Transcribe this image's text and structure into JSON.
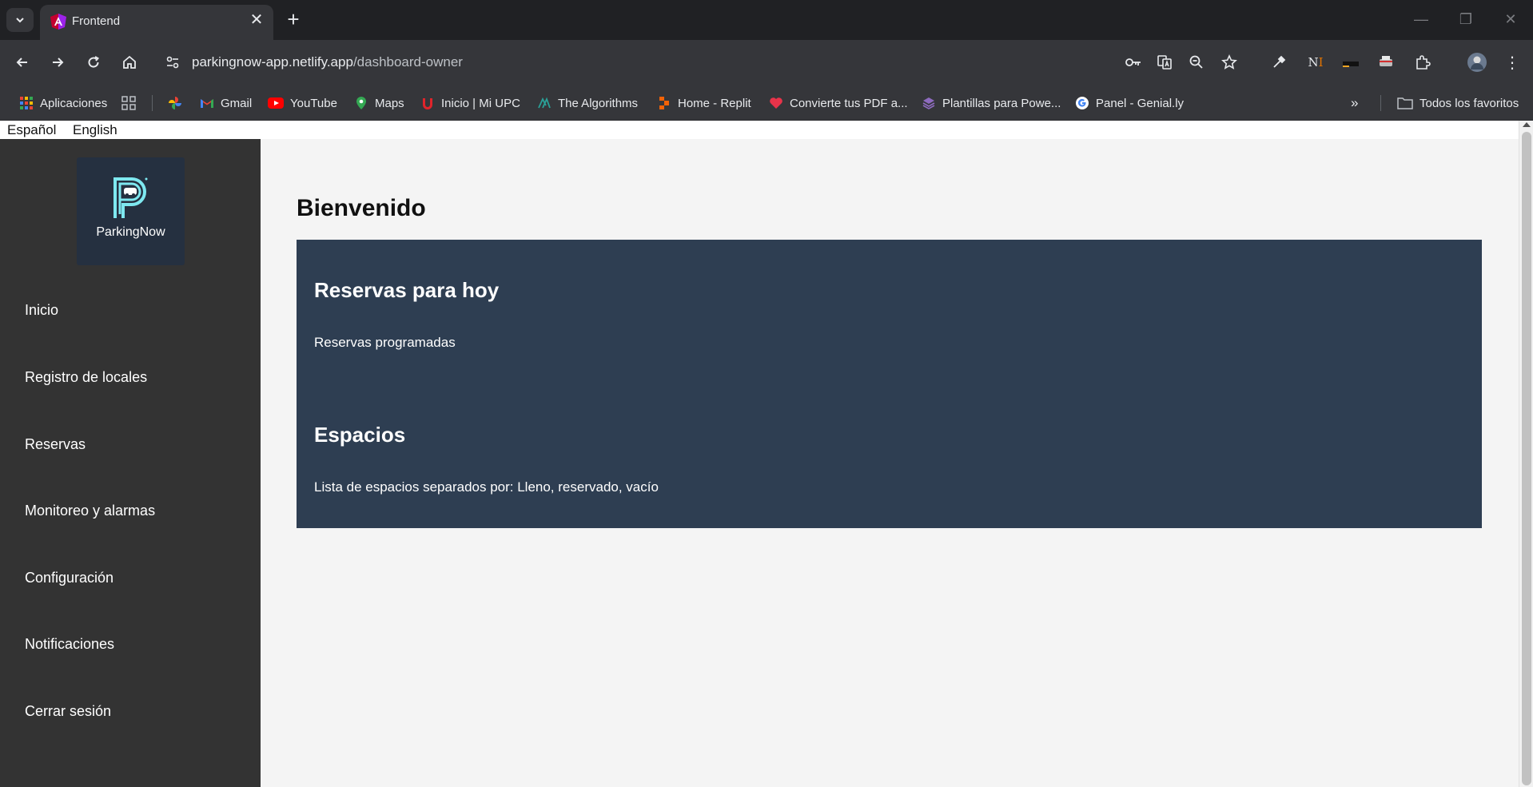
{
  "browser": {
    "tab_title": "Frontend",
    "url_host": "parkingnow-app.netlify.app",
    "url_path": "/dashboard-owner",
    "bookmarks": [
      "Aplicaciones",
      "Gmail",
      "YouTube",
      "Maps",
      "Inicio | Mi UPC",
      "The Algorithms",
      "Home - Replit",
      "Convierte tus PDF a...",
      "Plantillas para Powe...",
      "Panel - Genial.ly"
    ],
    "all_bookmarks": "Todos los favoritos"
  },
  "lang": {
    "es": "Español",
    "en": "English"
  },
  "sidebar": {
    "logo_text": "ParkingNow",
    "items": [
      "Inicio",
      "Registro de locales",
      "Reservas",
      "Monitoreo y alarmas",
      "Configuración",
      "Notificaciones",
      "Cerrar sesión"
    ]
  },
  "main": {
    "title": "Bienvenido",
    "sections": [
      {
        "heading": "Reservas para hoy",
        "text": "Reservas programadas"
      },
      {
        "heading": "Espacios",
        "text": "Lista de espacios separados por: Lleno, reservado, vacío"
      }
    ]
  },
  "colors": {
    "sidebar_bg": "#333333",
    "panel_bg": "#2e3e52",
    "logo_accent": "#7ee8f0"
  }
}
